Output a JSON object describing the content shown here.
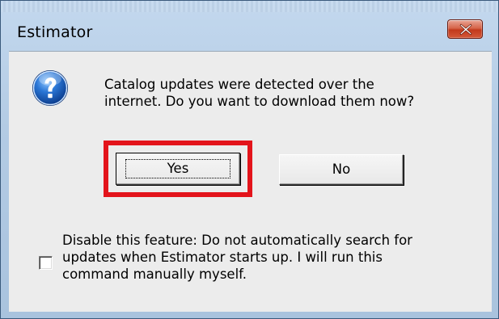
{
  "window": {
    "title": "Estimator",
    "close_icon": "close-icon"
  },
  "dialog": {
    "icon": "question-icon",
    "message_lines": [
      "Catalog updates were detected over the",
      "internet.  Do you want to download them now?"
    ],
    "buttons": {
      "yes_label": "Yes",
      "no_label": "No"
    },
    "highlight_color": "#e3141b",
    "checkbox": {
      "checked": false,
      "label_lines": [
        "Disable this feature:  Do not automatically search for",
        "updates when Estimator starts up.  I will run this",
        "command manually myself."
      ]
    }
  }
}
